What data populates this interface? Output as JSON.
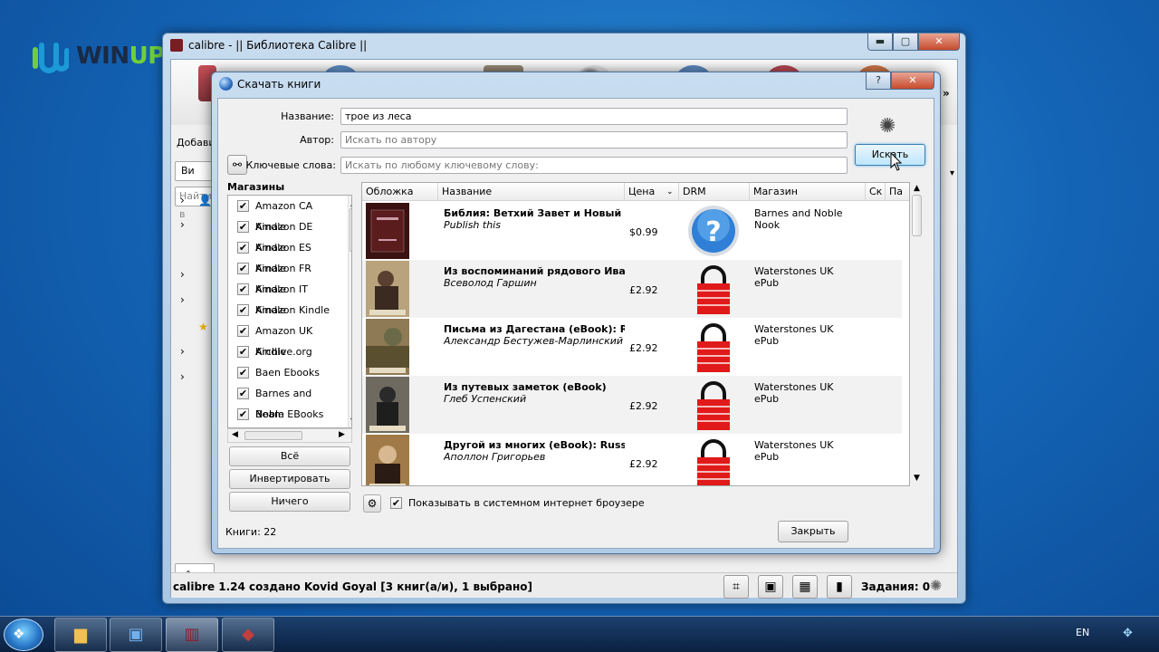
{
  "watermark": {
    "text_a": "WIN",
    "text_b": "UPDATE"
  },
  "main_window": {
    "title": "calibre - || Библиотека Calibre ||",
    "min": "▬",
    "max": "▢",
    "close": "✕",
    "add_label": "Добави",
    "view_label": "Ви",
    "find_placeholder": "Найти в",
    "status_text": "calibre 1.24 создано Kovid Goyal    [3 книг(а/и), 1 выбрано]",
    "jobs_label": "Задания: 0",
    "more": "»"
  },
  "dialog": {
    "title": "Скачать книги",
    "help": "?",
    "close": "✕",
    "name_label": "Название:",
    "name_value": "трое из леса",
    "author_label": "Автор:",
    "author_placeholder": "Искать по автору",
    "keywords_label": "Ключевые слова:",
    "keywords_placeholder": "Искать по любому ключевому слову:",
    "search_button": "Искать",
    "stores_title": "Магазины",
    "stores": [
      "Amazon CA Kindle",
      "Amazon DE Kindle",
      "Amazon ES Kindle",
      "Amazon FR Kindle",
      "Amazon IT Kindle",
      "Amazon Kindle",
      "Amazon UK Kindle",
      "Archive.org",
      "Baen Ebooks",
      "Barnes and Noble",
      "Beam EBooks DE"
    ],
    "btn_all": "Всё",
    "btn_invert": "Инвертировать",
    "btn_none": "Ничего",
    "books_count": "Книги:  22",
    "columns": [
      "Обложка",
      "Название",
      "Цена",
      "DRM",
      "Магазин",
      "Ск",
      "Па"
    ],
    "results": [
      {
        "title": "Библия: Ветхий Завет и Новый Заве",
        "author": "Publish this",
        "price": "$0.99",
        "drm": "unknown",
        "store": "Barnes and Noble",
        "format": "Nook"
      },
      {
        "title": "Из воспоминаний рядового Иванов",
        "author": "Всеволод Гаршин",
        "price": "£2.92",
        "drm": "locked",
        "store": "Waterstones UK",
        "format": "ePub"
      },
      {
        "title": "Письма из Дагестана (eBook): Russ",
        "author": "Александр Бестужев-Марлинский",
        "price": "£2.92",
        "drm": "locked",
        "store": "Waterstones UK",
        "format": "ePub"
      },
      {
        "title": "Из путевых заметок (eBook)",
        "author": "Глеб Успенский",
        "price": "£2.92",
        "drm": "locked",
        "store": "Waterstones UK",
        "format": "ePub"
      },
      {
        "title": "Другой из многих (eBook): Russian",
        "author": "Аполлон Григорьев",
        "price": "£2.92",
        "drm": "locked",
        "store": "Waterstones UK",
        "format": "ePub"
      }
    ],
    "system_browser_label": "Показывать в системном интернет броузере",
    "close_button": "Закрыть"
  },
  "taskbar": {
    "lang": "EN"
  },
  "colors": {
    "accent": "#3c7fb1",
    "lock_red": "#e01a1a",
    "desktop": "#1566b8"
  }
}
